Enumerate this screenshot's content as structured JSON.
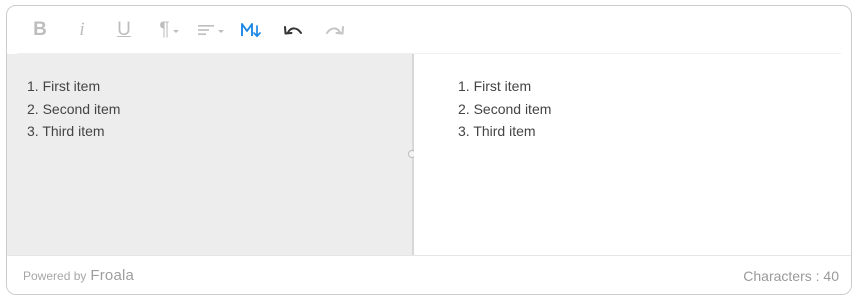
{
  "toolbar": {
    "buttons": [
      {
        "name": "bold",
        "glyph": "B"
      },
      {
        "name": "italic",
        "glyph": "i"
      },
      {
        "name": "underline",
        "glyph": "U"
      },
      {
        "name": "paragraph-format",
        "glyph": "¶"
      }
    ]
  },
  "editor": {
    "source_list": [
      "1. First item",
      "2. Second item",
      "3. Third item"
    ],
    "preview_list": [
      "1. First item",
      "2. Second item",
      "3. Third item"
    ]
  },
  "footer": {
    "powered_by": "Powered by",
    "brand": "Froala",
    "char_count": "Characters : 40"
  },
  "colors": {
    "accent": "#1e88e5",
    "icon_disabled": "#bdbdbd",
    "icon_active": "#333333",
    "pane_left_bg": "#ededed"
  }
}
